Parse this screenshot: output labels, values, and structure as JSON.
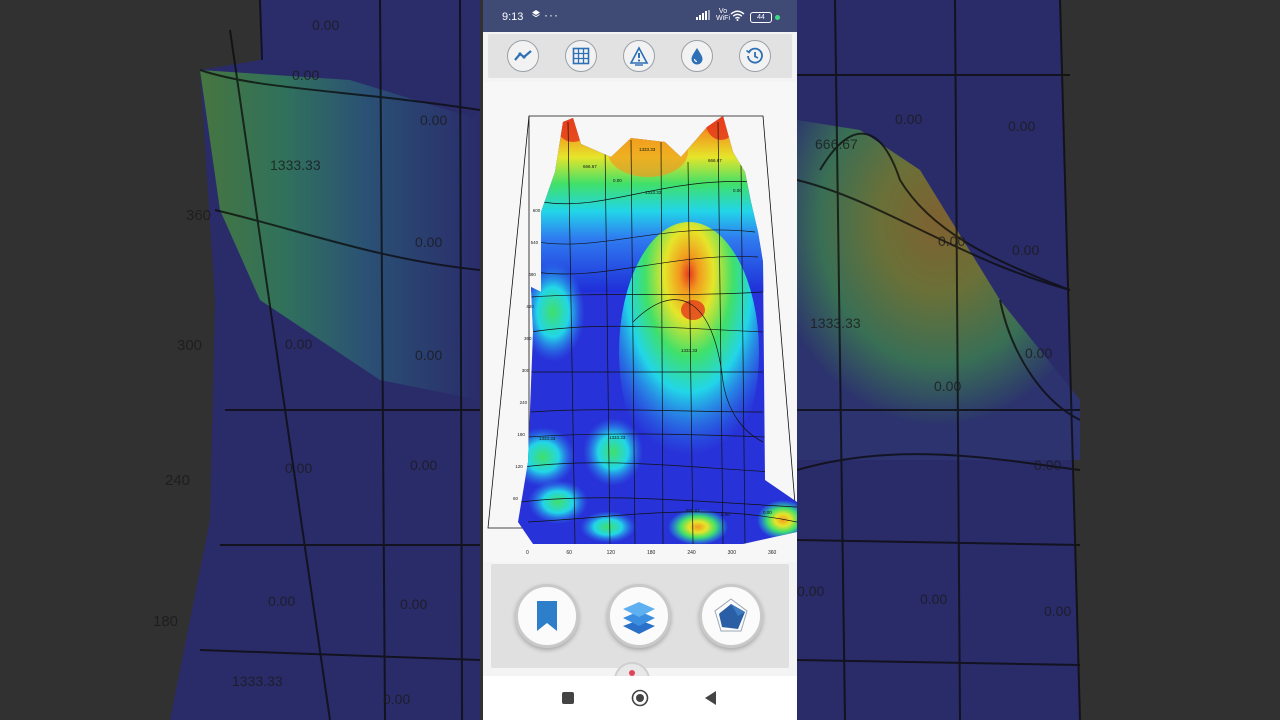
{
  "status_bar": {
    "time": "9:13",
    "more_indicator": "···",
    "network_label_top": "Vo",
    "network_label_bottom": "WiFi",
    "battery": "44"
  },
  "toolbar": {
    "buttons": [
      {
        "name": "line-chart",
        "icon": "trend-line-icon"
      },
      {
        "name": "grid",
        "icon": "grid-icon"
      },
      {
        "name": "warning-profile",
        "icon": "warning-triangle-icon"
      },
      {
        "name": "moisture",
        "icon": "water-drop-icon"
      },
      {
        "name": "history",
        "icon": "history-clock-icon"
      }
    ]
  },
  "chart_data": {
    "type": "heatmap",
    "x_ticks": [
      "0",
      "60",
      "120",
      "180",
      "240",
      "300",
      "360"
    ],
    "y_ticks": [
      "60",
      "120",
      "180",
      "240",
      "300",
      "360",
      "420",
      "480",
      "540",
      "600"
    ],
    "cell_labels": [
      "1333.33",
      "666.67",
      "0.00",
      "1333.33",
      "666.67",
      "0.00",
      "1333.33",
      "1333.33",
      "666.67",
      "0.00",
      "1333.33",
      "0.00"
    ],
    "color_scale": [
      "#1f2ed8",
      "#2f7cf0",
      "#22d6e8",
      "#40e06a",
      "#e6e52a",
      "#f29a1e",
      "#e53a1c"
    ]
  },
  "backdrop": {
    "labels_left": [
      "0.00",
      "0.00",
      "1333.33",
      "0.00",
      "0.00",
      "0.00",
      "0.00",
      "0.00",
      "0.00",
      "0.00",
      "0.00",
      "1333.33",
      "0.00"
    ],
    "axis_left": [
      "360",
      "300",
      "240",
      "180"
    ],
    "labels_right": [
      "0.00",
      "0.00",
      "0.00",
      "1333.33",
      "0.00",
      "0.00",
      "0.00",
      "0.00",
      "0.00",
      "0.00",
      "0.00",
      "0.00"
    ],
    "peak_label": "666.67"
  },
  "bottom_actions": [
    {
      "name": "bookmark",
      "icon": "bookmark-icon"
    },
    {
      "name": "layers",
      "icon": "layers-icon"
    },
    {
      "name": "radar",
      "icon": "radar-icon"
    }
  ],
  "colors": {
    "status_bar": "#3f4a75",
    "icon_blue": "#2e6fb5",
    "panel_gray": "#e0e0e0"
  }
}
